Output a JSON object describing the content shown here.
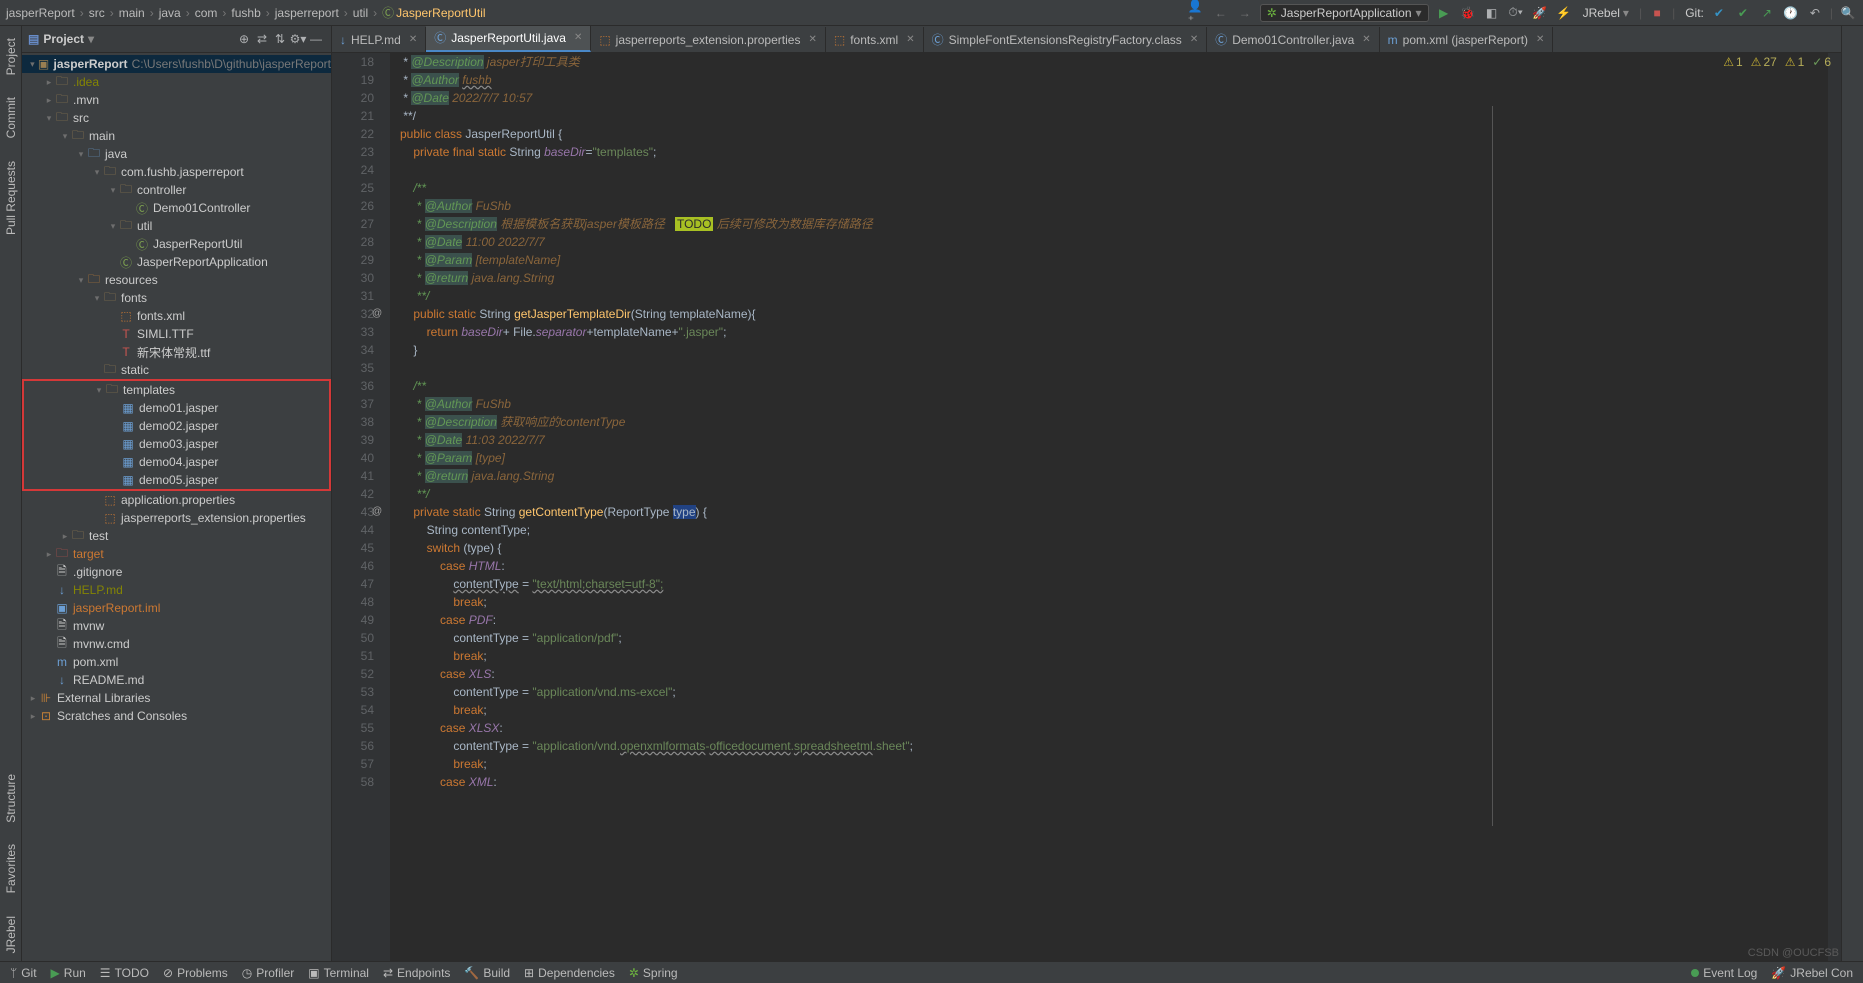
{
  "breadcrumbs": [
    "jasperReport",
    "src",
    "main",
    "java",
    "com",
    "fushb",
    "jasperreport",
    "util",
    "JasperReportUtil"
  ],
  "run_config": "JasperReportApplication",
  "jrebel_label": "JRebel",
  "git_label": "Git:",
  "project_label": "Project",
  "project_root": "jasperReport",
  "project_path": "C:\\Users\\fushb\\D\\github\\jasperReport",
  "tree": {
    "idea": ".idea",
    "mvn": ".mvn",
    "src": "src",
    "main": "main",
    "java": "java",
    "pkg": "com.fushb.jasperreport",
    "controller": "controller",
    "demo01": "Demo01Controller",
    "util": "util",
    "jru": "JasperReportUtil",
    "jra": "JasperReportApplication",
    "resources": "resources",
    "fonts": "fonts",
    "fontsxml": "fonts.xml",
    "simli": "SIMLI.TTF",
    "xst": "新宋体常规.ttf",
    "static": "static",
    "templates": "templates",
    "d1": "demo01.jasper",
    "d2": "demo02.jasper",
    "d3": "demo03.jasper",
    "d4": "demo04.jasper",
    "d5": "demo05.jasper",
    "appprops": "application.properties",
    "jrext": "jasperreports_extension.properties",
    "test": "test",
    "target": "target",
    "gitignore": ".gitignore",
    "help": "HELP.md",
    "iml": "jasperReport.iml",
    "mvnw": "mvnw",
    "mvnwcmd": "mvnw.cmd",
    "pom": "pom.xml",
    "readme": "README.md",
    "extlib": "External Libraries",
    "scratches": "Scratches and Consoles"
  },
  "tabs": [
    {
      "name": "HELP.md",
      "icon": "md"
    },
    {
      "name": "JasperReportUtil.java",
      "icon": "class",
      "active": true
    },
    {
      "name": "jasperreports_extension.properties",
      "icon": "props"
    },
    {
      "name": "fonts.xml",
      "icon": "xml"
    },
    {
      "name": "SimpleFontExtensionsRegistryFactory.class",
      "icon": "class"
    },
    {
      "name": "Demo01Controller.java",
      "icon": "class"
    },
    {
      "name": "pom.xml (jasperReport)",
      "icon": "maven"
    }
  ],
  "warnings": {
    "a": "1",
    "b": "27",
    "c": "1",
    "d": "6"
  },
  "lines": {
    "18": {
      "t": " * <span class='doctag'>@Description</span> <span class='docparam'>jasper打印工具类</span>"
    },
    "19": {
      "t": " * <span class='doctag'>@Author</span> <span class='docparam err'>fushb</span>"
    },
    "20": {
      "t": " * <span class='doctag'>@Date</span> <span class='docparam'>2022/7/7 10:57</span>"
    },
    "21": {
      "t": " **/"
    },
    "22": {
      "t": "<span class='kw'>public class</span> JasperReportUtil {"
    },
    "23": {
      "t": "    <span class='kw'>private final static</span> String <span class='field'>baseDir</span>=<span class='str'>\"templates\"</span>;"
    },
    "24": {
      "t": ""
    },
    "25": {
      "t": "    <span class='doc'>/**</span>"
    },
    "26": {
      "t": "<span class='doc'>     * <span class='doctag'>@Author</span> <span class='docparam'>FuShb</span></span>"
    },
    "27": {
      "t": "<span class='doc'>     * <span class='doctag'>@Description</span> <span class='docparam'>根据模板名获取jasper模板路径</span>   <span class='todo'>TODO</span> <span class='docparam'>后续可修改为数据库存储路径</span></span>"
    },
    "28": {
      "t": "<span class='doc'>     * <span class='doctag'>@Date</span> <span class='docparam'>11:00 2022/7/7</span></span>"
    },
    "29": {
      "t": "<span class='doc'>     * <span class='doctag'>@Param</span> <span class='docparam'>[templateName]</span></span>"
    },
    "30": {
      "t": "<span class='doc'>     * <span class='doctag'>@return</span> <span class='docparam'>java.lang.String</span></span>"
    },
    "31": {
      "t": "<span class='doc'>     **/</span>"
    },
    "32": {
      "t": "    <span class='kw'>public static</span> String <span class='fn'>getJasperTemplateDir</span>(String templateName){",
      "gicon": "@"
    },
    "33": {
      "t": "        <span class='kw'>return</span> <span class='field'>baseDir</span>+ File.<span class='field'>separator</span>+templateName+<span class='str'>\".jasper\"</span>;"
    },
    "34": {
      "t": "    }"
    },
    "35": {
      "t": ""
    },
    "36": {
      "t": "    <span class='doc'>/**</span>"
    },
    "37": {
      "t": "<span class='doc'>     * <span class='doctag'>@Author</span> <span class='docparam'>FuShb</span></span>"
    },
    "38": {
      "t": "<span class='doc'>     * <span class='doctag'>@Description</span> <span class='docparam'>获取响应的contentType</span></span>"
    },
    "39": {
      "t": "<span class='doc'>     * <span class='doctag'>@Date</span> <span class='docparam'>11:03 2022/7/7</span></span>"
    },
    "40": {
      "t": "<span class='doc'>     * <span class='doctag'>@Param</span> <span class='docparam'>[type]</span></span>"
    },
    "41": {
      "t": "<span class='doc'>     * <span class='doctag'>@return</span> <span class='docparam'>java.lang.String</span></span>"
    },
    "42": {
      "t": "<span class='doc'>     **/</span>"
    },
    "43": {
      "t": "    <span class='kw'>private static</span> String <span class='fn'>getContentType</span>(ReportType <span class='hl'>type</span>) {",
      "gicon": "@"
    },
    "44": {
      "t": "        String contentType;"
    },
    "45": {
      "t": "        <span class='kw'>switch</span> (type) {"
    },
    "46": {
      "t": "            <span class='kw'>case</span> <span class='const'>HTML</span>:"
    },
    "47": {
      "t": "                <span class='err'>contentType</span> = <span class='str err'>\"text/html;charset=utf-8\";</span>"
    },
    "48": {
      "t": "                <span class='kw'>break</span>;"
    },
    "49": {
      "t": "            <span class='kw'>case</span> <span class='const'>PDF</span>:"
    },
    "50": {
      "t": "                contentType = <span class='str'>\"application/pdf\"</span>;"
    },
    "51": {
      "t": "                <span class='kw'>break</span>;"
    },
    "52": {
      "t": "            <span class='kw'>case</span> <span class='const'>XLS</span>:"
    },
    "53": {
      "t": "                contentType = <span class='str'>\"application/vnd.ms-excel\"</span>;"
    },
    "54": {
      "t": "                <span class='kw'>break</span>;"
    },
    "55": {
      "t": "            <span class='kw'>case</span> <span class='const'>XLSX</span>:"
    },
    "56": {
      "t": "                contentType = <span class='str'>\"application/vnd.<span class='err'>openxmlformats</span>-<span class='err'>officedocument</span>.<span class='err'>spreadsheetml</span>.sheet\"</span>;"
    },
    "57": {
      "t": "                <span class='kw'>break</span>;"
    },
    "58": {
      "t": "            <span class='kw'>case</span> <span class='const'>XML</span>:"
    }
  },
  "status": {
    "git": "Git",
    "run": "Run",
    "todo": "TODO",
    "problems": "Problems",
    "profiler": "Profiler",
    "terminal": "Terminal",
    "endpoints": "Endpoints",
    "build": "Build",
    "dependencies": "Dependencies",
    "spring": "Spring",
    "eventlog": "Event Log",
    "jrebelcon": "JRebel Con"
  },
  "leftbar": {
    "project": "Project",
    "commit": "Commit",
    "pullreq": "Pull Requests",
    "structure": "Structure",
    "favorites": "Favorites",
    "jrebel": "JRebel"
  },
  "watermark": "CSDN @OUCFSB"
}
